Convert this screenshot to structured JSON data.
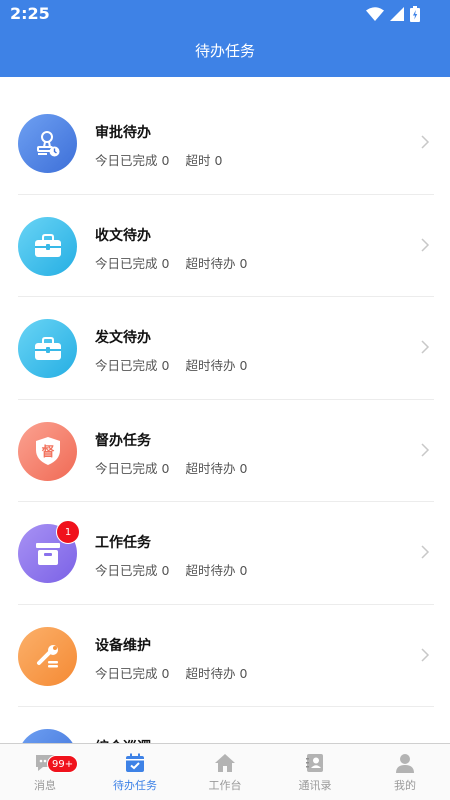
{
  "status_bar": {
    "time": "2:25"
  },
  "header": {
    "title": "待办任务"
  },
  "tasks": [
    {
      "title": "审批待办",
      "done_label": "今日已完成",
      "done_count": "0",
      "overdue_label": "超时",
      "overdue_count": "0",
      "icon": "stamp-icon",
      "badge": ""
    },
    {
      "title": "收文待办",
      "done_label": "今日已完成",
      "done_count": "0",
      "overdue_label": "超时待办",
      "overdue_count": "0",
      "icon": "briefcase-icon",
      "badge": ""
    },
    {
      "title": "发文待办",
      "done_label": "今日已完成",
      "done_count": "0",
      "overdue_label": "超时待办",
      "overdue_count": "0",
      "icon": "briefcase-icon",
      "badge": ""
    },
    {
      "title": "督办任务",
      "done_label": "今日已完成",
      "done_count": "0",
      "overdue_label": "超时待办",
      "overdue_count": "0",
      "icon": "shield-icon",
      "icon_text": "督",
      "badge": ""
    },
    {
      "title": "工作任务",
      "done_label": "今日已完成",
      "done_count": "0",
      "overdue_label": "超时待办",
      "overdue_count": "0",
      "icon": "archive-box-icon",
      "badge": "1"
    },
    {
      "title": "设备维护",
      "done_label": "今日已完成",
      "done_count": "0",
      "overdue_label": "超时待办",
      "overdue_count": "0",
      "icon": "wrench-icon",
      "badge": ""
    },
    {
      "title": "综合巡逻",
      "icon": "patrol-icon"
    }
  ],
  "tabbar": {
    "items": [
      {
        "label": "消息",
        "icon": "chat-icon",
        "badge": "99+"
      },
      {
        "label": "待办任务",
        "icon": "calendar-check-icon",
        "active": true
      },
      {
        "label": "工作台",
        "icon": "home-icon"
      },
      {
        "label": "通讯录",
        "icon": "contacts-icon"
      },
      {
        "label": "我的",
        "icon": "user-icon"
      }
    ]
  },
  "colors": {
    "primary": "#3E82E6",
    "badge_red": "#F0121C",
    "approval_icon": "#4F7FE0",
    "document_icon": "#3BBEEA",
    "supervise_icon": "#F6836E",
    "work_icon": "#8F78EE",
    "maintenance_icon": "#F89A48"
  }
}
